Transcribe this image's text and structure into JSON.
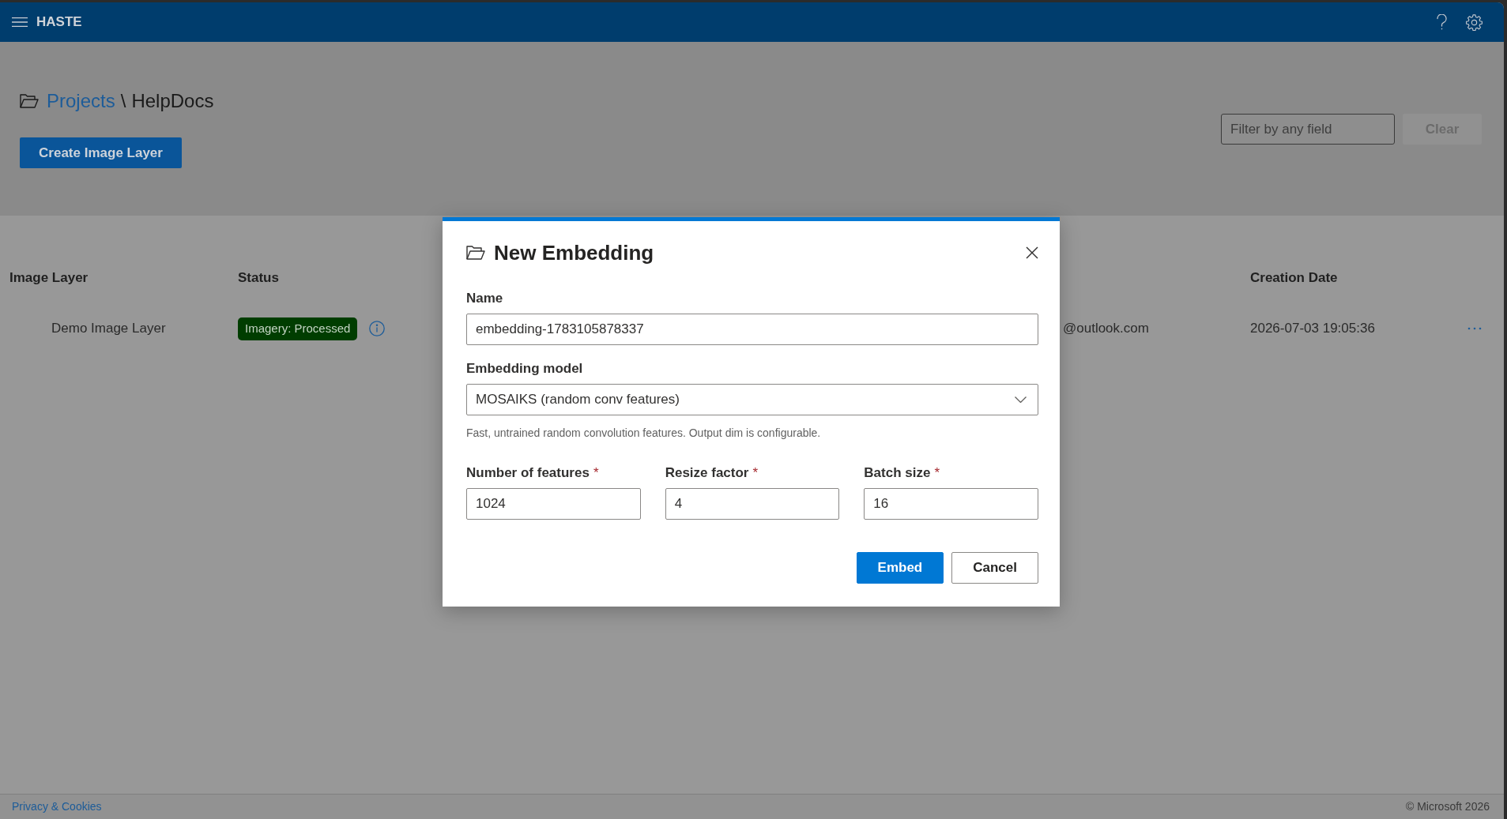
{
  "top_bar": {
    "title": "HASTE"
  },
  "breadcrumb": {
    "link": "Projects",
    "separator": "\\",
    "current": "HelpDocs"
  },
  "toolbar": {
    "create_button": "Create Image Layer",
    "filter": {
      "placeholder": "Filter by any field"
    },
    "clear_button": {
      "label": "Clear",
      "disabled": true
    }
  },
  "table": {
    "columns": [
      {
        "label": "Image Layer"
      },
      {
        "label": "Status"
      },
      {
        "label": "Creation Date"
      }
    ],
    "rows": [
      {
        "image_layer": "Demo Image Layer",
        "status": "Imagery: Processed",
        "owner": "@outlook.com",
        "creation_date": "2026-07-03 19:05:36"
      }
    ]
  },
  "dialog": {
    "title": "New Embedding",
    "name_field": {
      "label": "Name",
      "value": "embedding-1783105878337"
    },
    "model_field": {
      "label": "Embedding model",
      "value": "MOSAIKS (random conv features)",
      "hint": "Fast, untrained random convolution features. Output dim is configurable."
    },
    "parameters": [
      {
        "label": "Number of features",
        "required_mark": "*",
        "value": "1024"
      },
      {
        "label": "Resize factor",
        "required_mark": "*",
        "value": "4"
      },
      {
        "label": "Batch size",
        "required_mark": "*",
        "value": "16"
      }
    ],
    "buttons": [
      {
        "label": "Embed",
        "primary": true
      },
      {
        "label": "Cancel",
        "primary": false
      }
    ]
  },
  "footer": {
    "link": "Privacy & Cookies",
    "copyright": "© Microsoft 2026"
  }
}
